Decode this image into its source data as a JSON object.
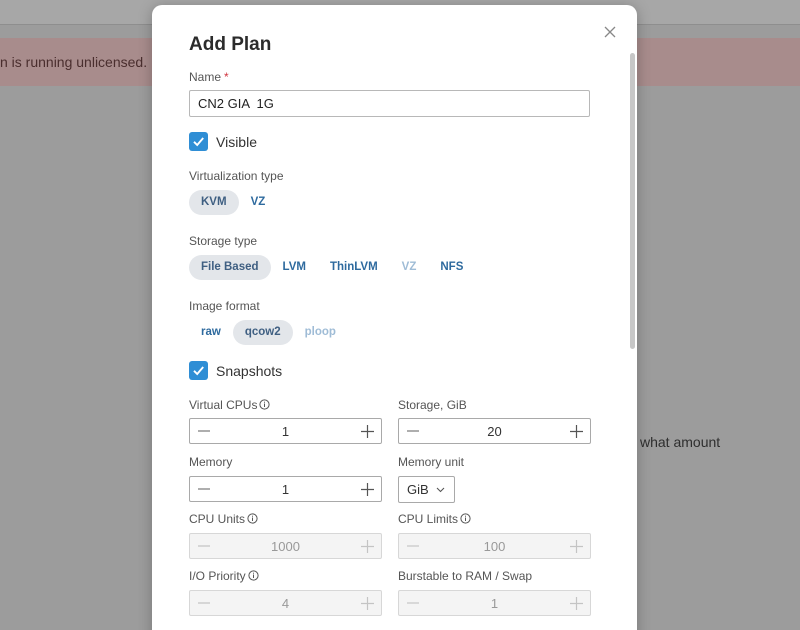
{
  "background": {
    "banner_text": "n is running unlicensed.",
    "right_text": "what amount"
  },
  "modal": {
    "title": "Add Plan",
    "name": {
      "label": "Name",
      "required_mark": "*",
      "value": "CN2 GIA  1G"
    },
    "visible": {
      "label": "Visible",
      "checked": true
    },
    "virtualization": {
      "label": "Virtualization type",
      "options": [
        "KVM",
        "VZ"
      ],
      "selected": "KVM"
    },
    "storage_type": {
      "label": "Storage type",
      "options": [
        "File Based",
        "LVM",
        "ThinLVM",
        "VZ",
        "NFS"
      ],
      "selected": "File Based",
      "disabled": [
        "VZ"
      ]
    },
    "image_format": {
      "label": "Image format",
      "options": [
        "raw",
        "qcow2",
        "ploop"
      ],
      "selected": "qcow2",
      "disabled": [
        "ploop"
      ]
    },
    "snapshots": {
      "label": "Snapshots",
      "checked": true
    },
    "virtual_cpus": {
      "label": "Virtual CPUs",
      "value": "1"
    },
    "storage": {
      "label": "Storage, GiB",
      "value": "20"
    },
    "memory": {
      "label": "Memory",
      "value": "1"
    },
    "memory_unit": {
      "label": "Memory unit",
      "value": "GiB"
    },
    "cpu_units": {
      "label": "CPU Units",
      "value": "1000"
    },
    "cpu_limits": {
      "label": "CPU Limits",
      "value": "100"
    },
    "io_priority": {
      "label": "I/O Priority",
      "value": "4"
    },
    "burstable": {
      "label": "Burstable to RAM / Swap",
      "value": "1"
    }
  },
  "colors": {
    "accent": "#2f8ed5",
    "link": "#2e6a9e",
    "segment_active_bg": "#e3e6ea",
    "required": "#d0353f"
  }
}
